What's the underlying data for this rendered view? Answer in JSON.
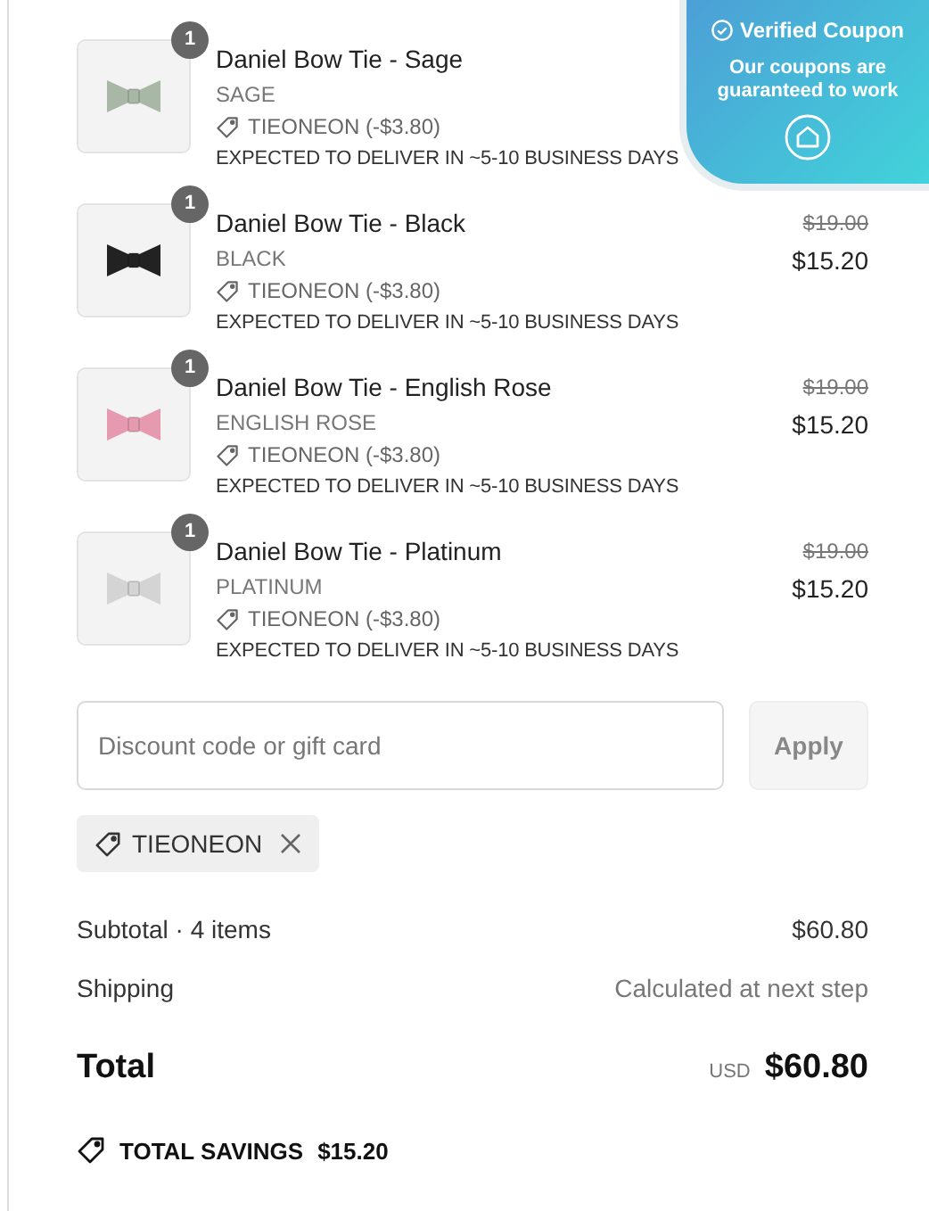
{
  "items": [
    {
      "quantity": "1",
      "name": "Daniel Bow Tie - Sage",
      "variant": "SAGE",
      "discount": "TIEONEON (-$3.80)",
      "delivery": "EXPECTED TO DELIVER IN ~5-10 BUSINESS DAYS"
    },
    {
      "quantity": "1",
      "name": "Daniel Bow Tie - Black",
      "variant": "BLACK",
      "discount": "TIEONEON (-$3.80)",
      "delivery": "EXPECTED TO DELIVER IN ~5-10 BUSINESS DAYS",
      "original_price": "$19.00",
      "price": "$15.20"
    },
    {
      "quantity": "1",
      "name": "Daniel Bow Tie - English Rose",
      "variant": "ENGLISH ROSE",
      "discount": "TIEONEON (-$3.80)",
      "delivery": "EXPECTED TO DELIVER IN ~5-10 BUSINESS DAYS",
      "original_price": "$19.00",
      "price": "$15.20"
    },
    {
      "quantity": "1",
      "name": "Daniel Bow Tie - Platinum",
      "variant": "PLATINUM",
      "discount": "TIEONEON (-$3.80)",
      "delivery": "EXPECTED TO DELIVER IN ~5-10 BUSINESS DAYS",
      "original_price": "$19.00",
      "price": "$15.20"
    }
  ],
  "discount_field": {
    "placeholder": "Discount code or gift card"
  },
  "apply_button": "Apply",
  "applied_code": "TIEONEON",
  "subtotal": {
    "label": "Subtotal · 4 items",
    "value": "$60.80"
  },
  "shipping": {
    "label": "Shipping",
    "value": "Calculated at next step"
  },
  "total": {
    "label": "Total",
    "currency": "USD",
    "value": "$60.80"
  },
  "savings": {
    "label": "TOTAL SAVINGS",
    "value": "$15.20"
  },
  "coupon_badge": {
    "title": "Verified Coupon",
    "text": "Our coupons are guaranteed to work"
  }
}
